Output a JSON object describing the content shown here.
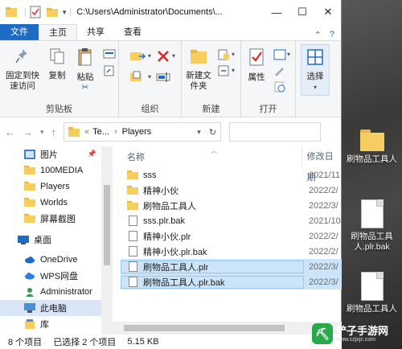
{
  "window": {
    "path_title": "C:\\Users\\Administrator\\Documents\\...",
    "controls": {
      "minimize": "—",
      "maximize": "☐",
      "close": "✕"
    }
  },
  "tabs": {
    "file": "文件",
    "home": "主页",
    "share": "共享",
    "view": "查看"
  },
  "ribbon": {
    "pin_label": "固定到快速访问",
    "copy_label": "复制",
    "paste_label": "粘贴",
    "clipboard_group": "剪贴板",
    "organize_group": "组织",
    "new_folder_label": "新建文件夹",
    "new_group": "新建",
    "properties_label": "属性",
    "open_group": "打开",
    "select_label": "选择"
  },
  "address": {
    "segment1": "Te...",
    "segment2": "Players",
    "prefix": "«"
  },
  "sidebar": {
    "items": [
      {
        "label": "图片",
        "icon": "pictures-icon"
      },
      {
        "label": "100MEDIA",
        "icon": "folder-icon"
      },
      {
        "label": "Players",
        "icon": "folder-icon"
      },
      {
        "label": "Worlds",
        "icon": "folder-icon"
      },
      {
        "label": "屏幕截图",
        "icon": "folder-icon"
      },
      {
        "label": "桌面",
        "icon": "desktop-icon"
      },
      {
        "label": "OneDrive",
        "icon": "cloud-icon"
      },
      {
        "label": "WPS网盘",
        "icon": "cloud-icon"
      },
      {
        "label": "Administrator",
        "icon": "user-icon"
      },
      {
        "label": "此电脑",
        "icon": "pc-icon"
      },
      {
        "label": "库",
        "icon": "library-icon"
      }
    ]
  },
  "list": {
    "col_name": "名称",
    "col_date": "修改日期",
    "rows": [
      {
        "name": "sss",
        "type": "folder",
        "date": "2021/11"
      },
      {
        "name": "精神小伙",
        "type": "folder",
        "date": "2022/2/"
      },
      {
        "name": "刷物品工具人",
        "type": "folder",
        "date": "2022/3/"
      },
      {
        "name": "sss.plr.bak",
        "type": "file",
        "date": "2021/10"
      },
      {
        "name": "精神小伙.plr",
        "type": "file",
        "date": "2022/2/"
      },
      {
        "name": "精神小伙.plr.bak",
        "type": "file",
        "date": "2022/2/"
      },
      {
        "name": "刷物品工具人.plr",
        "type": "file",
        "date": "2022/3/",
        "selected": true
      },
      {
        "name": "刷物品工具人.plr.bak",
        "type": "file",
        "date": "2022/3/",
        "selected": true
      }
    ]
  },
  "status": {
    "count": "8 个项目",
    "selected": "已选择 2 个项目",
    "size": "5.15 KB"
  },
  "desktop": {
    "icon1": "刷物品工具人",
    "icon2": "刷物品工具人.plr.bak",
    "icon3": "刷物品工具人"
  },
  "watermark": {
    "title": "铲子手游网",
    "sub": "www.czjxjc.com"
  }
}
